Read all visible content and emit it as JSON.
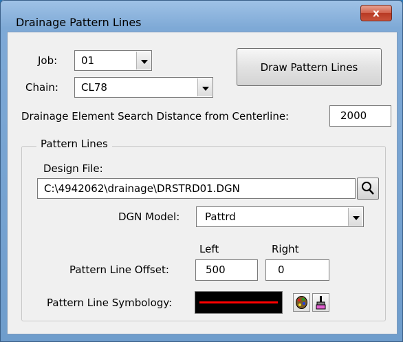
{
  "window": {
    "title": "Drainage Pattern Lines",
    "close_label": "x"
  },
  "job": {
    "label": "Job:",
    "value": "01"
  },
  "chain": {
    "label": "Chain:",
    "value": "CL78"
  },
  "draw_button": {
    "label": "Draw Pattern Lines"
  },
  "search_distance": {
    "label": "Drainage Element Search Distance from Centerline:",
    "value": "2000"
  },
  "pattern_lines": {
    "legend": "Pattern Lines",
    "design_file_label": "Design File:",
    "design_file_value": "C:\\4942062\\drainage\\DRSTRD01.DGN",
    "dgn_model_label": "DGN Model:",
    "dgn_model_value": "Pattrd",
    "left_label": "Left",
    "right_label": "Right",
    "offset_label": "Pattern Line Offset:",
    "offset_left": "500",
    "offset_right": "0",
    "symbology_label": "Pattern Line Symbology:",
    "symbology_line_color": "#ff0000"
  }
}
